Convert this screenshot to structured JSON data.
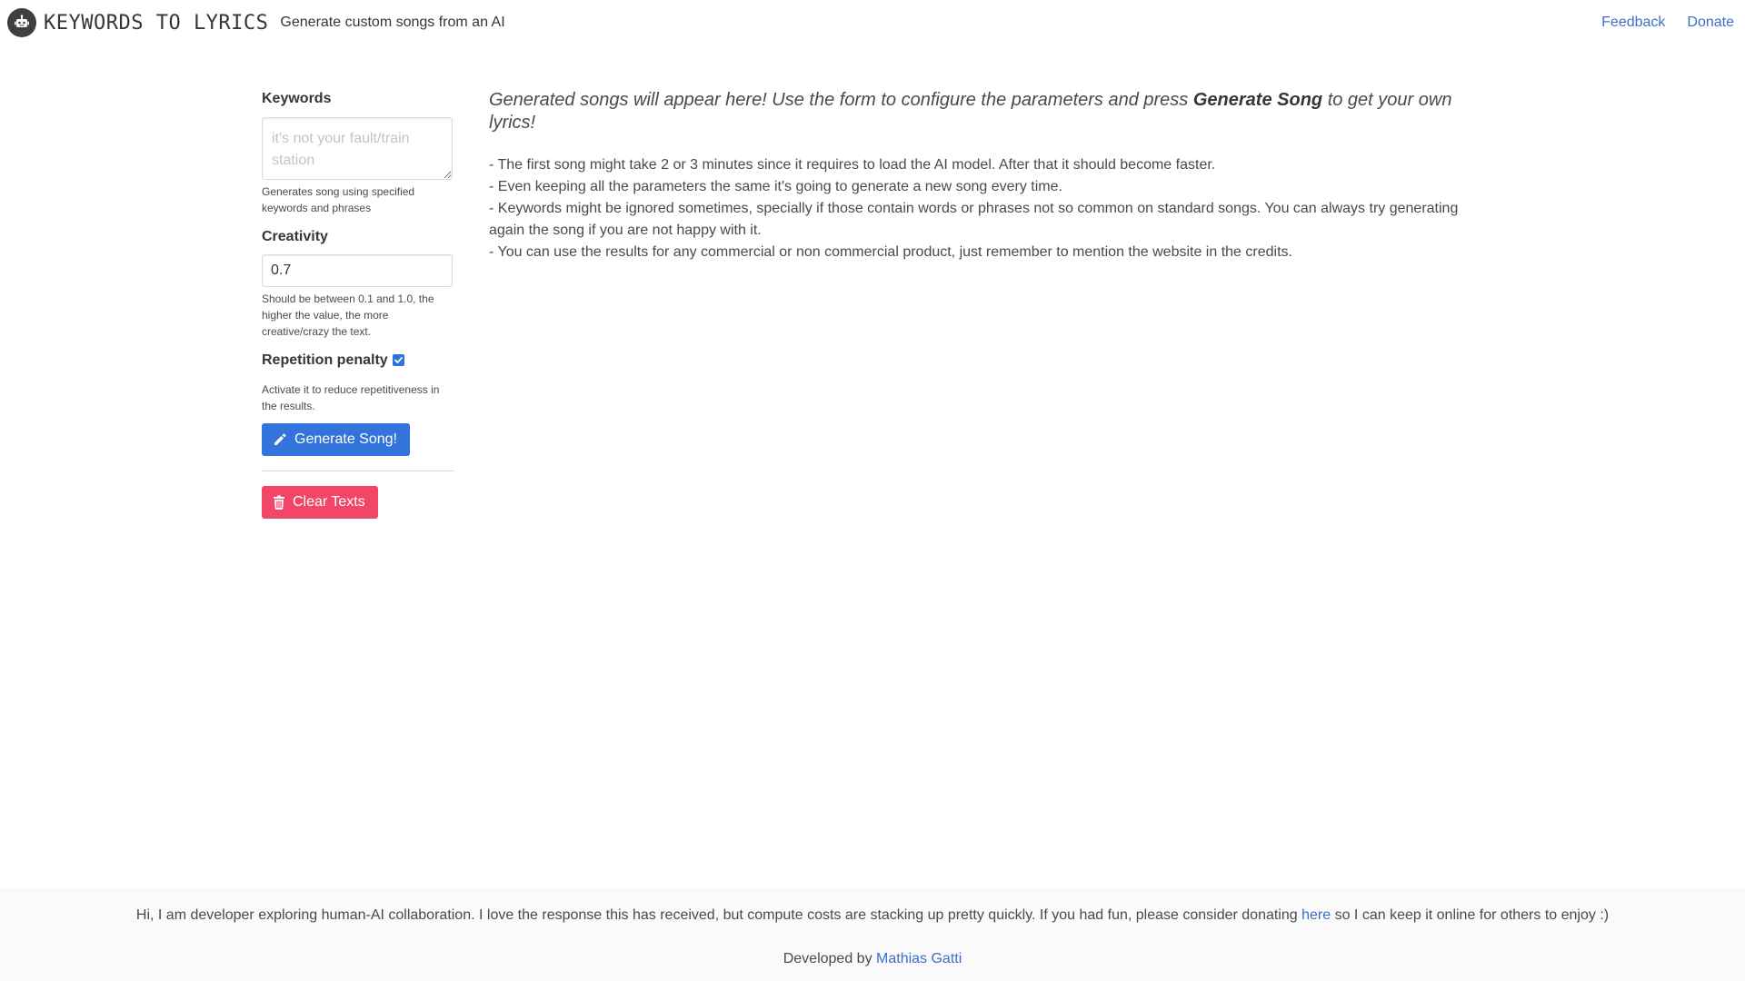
{
  "nav": {
    "logo_icon": "robot-icon",
    "title": "KEYWORDS TO LYRICS",
    "tagline": "Generate custom songs from an AI",
    "links": [
      {
        "label": "Feedback"
      },
      {
        "label": "Donate"
      }
    ],
    "link_color": "#3e6ec8"
  },
  "form": {
    "keywords": {
      "label": "Keywords",
      "value": "",
      "placeholder": "it's not your fault/train station",
      "help": "Generates song using specified keywords and phrases"
    },
    "creativity": {
      "label": "Creativity",
      "value": "0.7",
      "help": "Should be between 0.1 and 1.0, the higher the value, the more creative/crazy the text."
    },
    "repetition": {
      "label": "Repetition penalty",
      "checked": true,
      "help": "Activate it to reduce repetitiveness in the results."
    },
    "generate_button": {
      "label": "Generate Song!",
      "icon": "pencil-icon",
      "color": "#3273dc"
    },
    "clear_button": {
      "label": "Clear Texts",
      "icon": "trash-icon",
      "color": "#f14668"
    }
  },
  "main": {
    "intro_before": "Generated songs will appear here! Use the form to configure the parameters and press ",
    "intro_bold": "Generate Song",
    "intro_after": " to get your own lyrics!",
    "notes": [
      "- The first song might take 2 or 3 minutes since it requires to load the AI model. After that it should become faster.",
      "- Even keeping all the parameters the same it's going to generate a new song every time.",
      "- Keywords might be ignored sometimes, specially if those contain words or phrases not so common on standard songs. You can always try generating again the song if you are not happy with it.",
      "- You can use the results for any commercial or non commercial product, just remember to mention the website in the credits."
    ]
  },
  "footer": {
    "message_before": "Hi, I am developer exploring human-AI collaboration. I love the response this has received, but compute costs are stacking up pretty quickly. If you had fun, please consider donating ",
    "message_link": "here",
    "message_after": " so I can keep it online for others to enjoy :)",
    "credit_prefix": "Developed by ",
    "credit_link": "Mathias Gatti"
  }
}
